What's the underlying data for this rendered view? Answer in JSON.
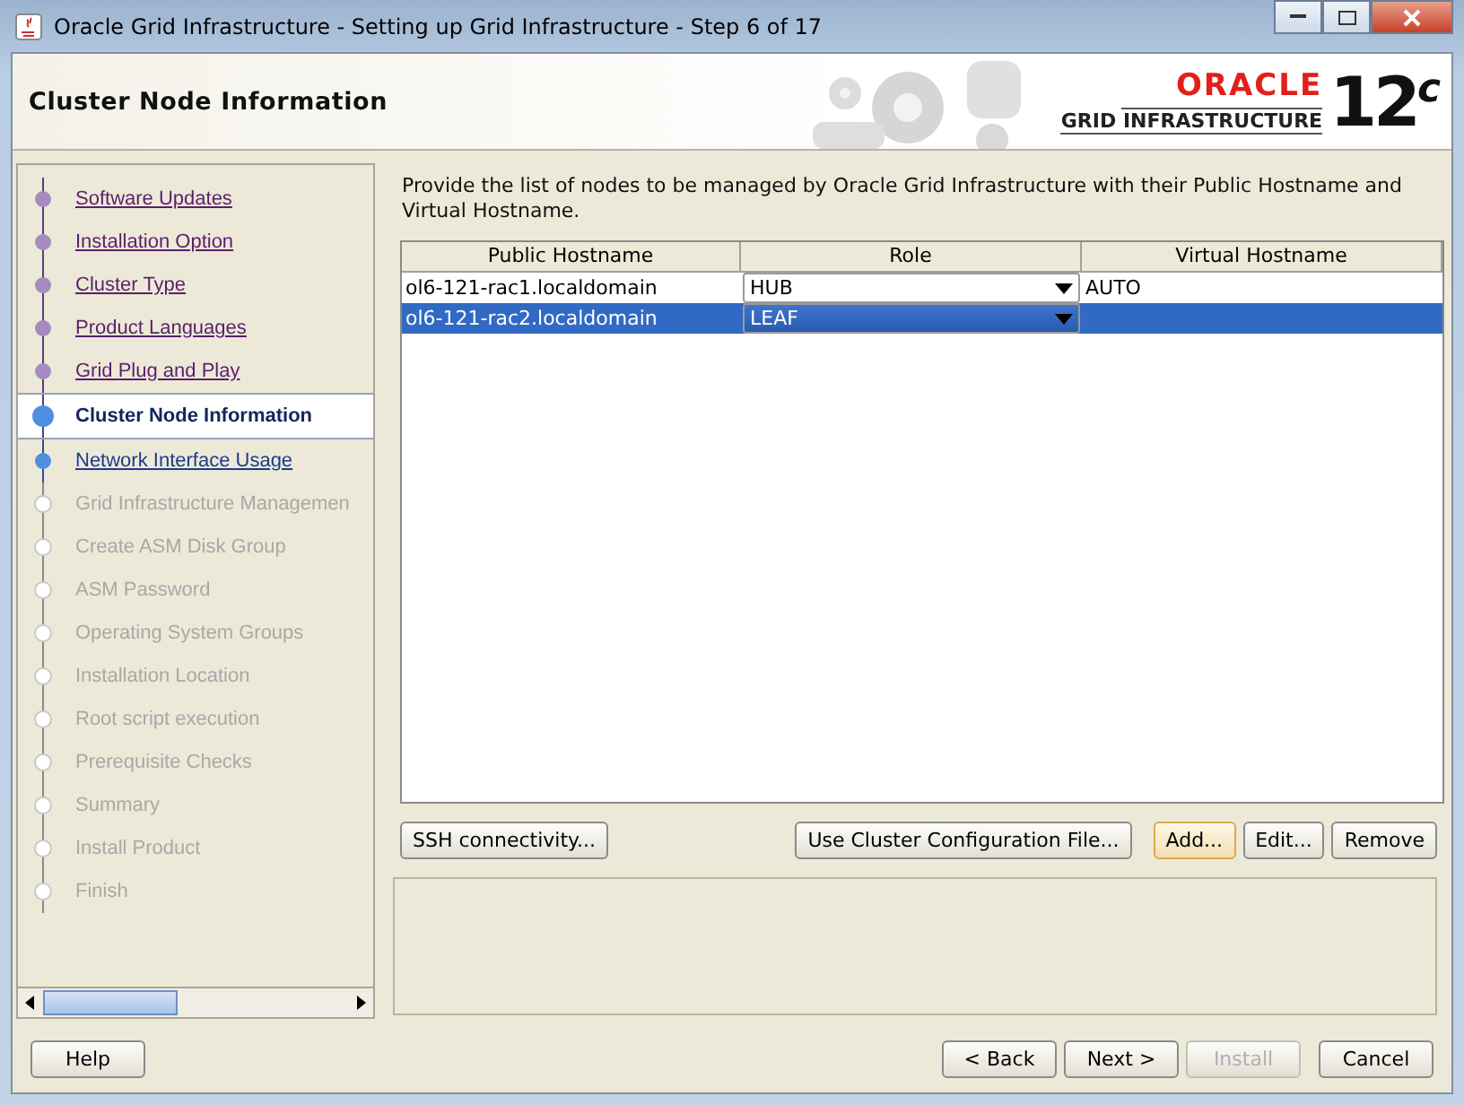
{
  "window": {
    "title": "Oracle Grid Infrastructure - Setting up Grid Infrastructure - Step 6 of 17"
  },
  "header": {
    "title": "Cluster Node Information",
    "logo": {
      "brand": "ORACLE",
      "product": "GRID INFRASTRUCTURE",
      "version": "12$^{c}$"
    }
  },
  "steps": [
    {
      "label": "Software Updates",
      "kind": "done",
      "selected": false
    },
    {
      "label": "Installation Option",
      "kind": "done",
      "selected": false
    },
    {
      "label": "Cluster Type",
      "kind": "done",
      "selected": false
    },
    {
      "label": "Product Languages",
      "kind": "done",
      "selected": false
    },
    {
      "label": "Grid Plug and Play",
      "kind": "done",
      "selected": false
    },
    {
      "label": "Cluster Node Information",
      "kind": "current",
      "selected": true
    },
    {
      "label": "Network Interface Usage",
      "kind": "next",
      "selected": false
    },
    {
      "label": "Grid Infrastructure Managemen",
      "kind": "pending",
      "selected": false
    },
    {
      "label": "Create ASM Disk Group",
      "kind": "pending",
      "selected": false
    },
    {
      "label": "ASM Password",
      "kind": "pending",
      "selected": false
    },
    {
      "label": "Operating System Groups",
      "kind": "pending",
      "selected": false
    },
    {
      "label": "Installation Location",
      "kind": "pending",
      "selected": false
    },
    {
      "label": "Root script execution",
      "kind": "pending",
      "selected": false
    },
    {
      "label": "Prerequisite Checks",
      "kind": "pending",
      "selected": false
    },
    {
      "label": "Summary",
      "kind": "pending",
      "selected": false
    },
    {
      "label": "Install Product",
      "kind": "pending",
      "selected": false
    },
    {
      "label": "Finish",
      "kind": "pending",
      "selected": false
    }
  ],
  "instructions": "Provide the list of nodes to be managed by Oracle Grid Infrastructure with their Public Hostname and Virtual Hostname.",
  "table": {
    "columns": [
      "Public Hostname",
      "Role",
      "Virtual Hostname"
    ],
    "rows": [
      {
        "public_hostname": "ol6-121-rac1.localdomain",
        "role": "HUB",
        "virtual_hostname": "AUTO",
        "selected": false
      },
      {
        "public_hostname": "ol6-121-rac2.localdomain",
        "role": "LEAF",
        "selected": true
      }
    ]
  },
  "table_buttons": [
    {
      "label": "SSH connectivity...",
      "focused": false
    },
    {
      "label": "Use Cluster Configuration File...",
      "focused": false
    },
    {
      "label": "Add...",
      "focused": true
    },
    {
      "label": "Edit...",
      "focused": false
    },
    {
      "label": "Remove",
      "focused": false
    }
  ],
  "footer_buttons": [
    {
      "label": "Help",
      "disabled": false
    },
    {
      "label": "< Back",
      "disabled": false
    },
    {
      "label": "Next >",
      "disabled": false
    },
    {
      "label": "Install",
      "disabled": true
    },
    {
      "label": "Cancel",
      "disabled": false
    }
  ]
}
